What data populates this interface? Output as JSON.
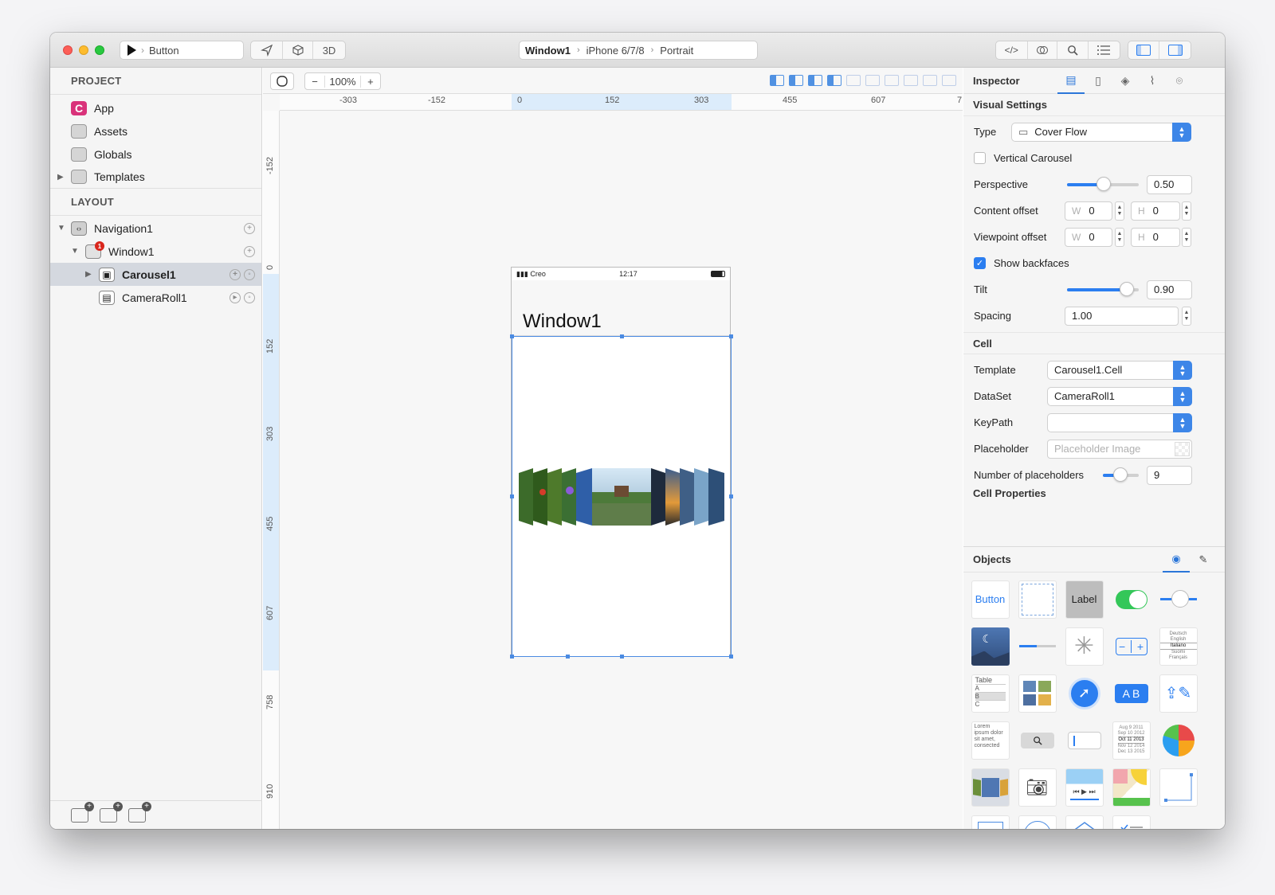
{
  "titlebar": {
    "run_target": "Button",
    "mode_3d": "3D",
    "breadcrumb": [
      "Window1",
      "iPhone 6/7/8",
      "Portrait"
    ]
  },
  "left_panel": {
    "project_header": "PROJECT",
    "project_items": [
      {
        "label": "App",
        "icon": "app-icon"
      },
      {
        "label": "Assets",
        "icon": "folder-icon"
      },
      {
        "label": "Globals",
        "icon": "folder-icon"
      },
      {
        "label": "Templates",
        "icon": "folder-icon"
      }
    ],
    "layout_header": "LAYOUT",
    "layout_items": [
      {
        "label": "Navigation1",
        "icon": "navigation-icon"
      },
      {
        "label": "Window1",
        "icon": "window-icon",
        "badge": "1"
      },
      {
        "label": "Carousel1",
        "icon": "carousel-icon"
      },
      {
        "label": "CameraRoll1",
        "icon": "cameraroll-icon"
      }
    ]
  },
  "canvas": {
    "zoom_minus": "−",
    "zoom_value": "100%",
    "zoom_plus": "+",
    "ruler_h": [
      "-303",
      "-152",
      "0",
      "152",
      "303",
      "455",
      "607",
      "7"
    ],
    "ruler_v": [
      "-152",
      "0",
      "152",
      "303",
      "455",
      "607",
      "758",
      "910"
    ]
  },
  "phone": {
    "carrier": "Creo",
    "time": "12:17",
    "title": "Window1"
  },
  "inspector": {
    "title": "Inspector",
    "visual_settings": "Visual Settings",
    "type_label": "Type",
    "type_value": "Cover Flow",
    "vertical_carousel": "Vertical Carousel",
    "vertical_carousel_checked": false,
    "perspective_label": "Perspective",
    "perspective_value": "0.50",
    "content_offset_label": "Content offset",
    "content_offset_w": "0",
    "content_offset_h": "0",
    "viewpoint_offset_label": "Viewpoint offset",
    "viewpoint_offset_w": "0",
    "viewpoint_offset_h": "0",
    "w_placeholder": "W",
    "h_placeholder": "H",
    "show_backfaces": "Show backfaces",
    "show_backfaces_checked": true,
    "tilt_label": "Tilt",
    "tilt_value": "0.90",
    "spacing_label": "Spacing",
    "spacing_value": "1.00",
    "cell_header": "Cell",
    "template_label": "Template",
    "template_value": "Carousel1.Cell",
    "dataset_label": "DataSet",
    "dataset_value": "CameraRoll1",
    "keypath_label": "KeyPath",
    "keypath_value": "",
    "placeholder_label": "Placeholder",
    "placeholder_placeholder": "Placeholder Image",
    "num_placeholders_label": "Number of placeholders",
    "num_placeholders_value": "9",
    "cell_properties_header": "Cell Properties"
  },
  "objects": {
    "title": "Objects",
    "button_label": "Button",
    "label_label": "Label",
    "table_label": "Table",
    "table_rows": [
      "A",
      "B",
      "C"
    ],
    "picker_items": [
      "Deutsch",
      "English",
      "Italiano",
      "Suomi",
      "Français"
    ],
    "lorem": "Lorem ipsum dolor sit amet, consected",
    "date_items": [
      "Aug 9 2011",
      "Sep 10 2012",
      "Oct 11 2013",
      "Nov 12 2014",
      "Dec 13 2015"
    ],
    "segmented": "A B"
  },
  "colors": {
    "accent": "#2b7ef0",
    "selection": "#4b8be2",
    "badge": "#d9261c",
    "app_icon": "#d9327a"
  }
}
